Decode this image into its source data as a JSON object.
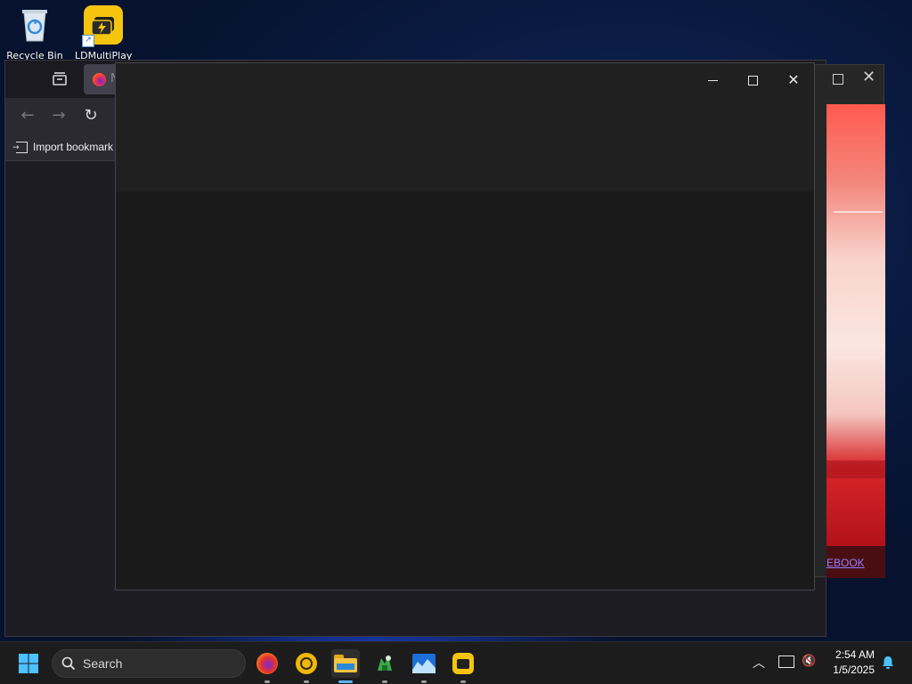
{
  "desktop": {
    "icons": [
      {
        "label": "Recycle Bin",
        "icon": "recycle-bin-icon"
      },
      {
        "label": "LDMultiPlayer",
        "icon": "ldmultiplayer-icon"
      }
    ]
  },
  "browser": {
    "tab_label": "N",
    "import_bookmarks_label": "Import bookmark",
    "icons": [
      "tab-overview-icon",
      "firefox-tab-icon",
      "back-arrow-icon",
      "forward-arrow-icon",
      "reload-icon",
      "import-icon"
    ]
  },
  "game_window": {
    "footer_link": "EBOOK"
  },
  "taskbar": {
    "search_label": "Search",
    "time": "2:54 AM",
    "date": "1/5/2025",
    "apps": [
      "firefox-icon",
      "ldplayer-icon",
      "file-explorer-icon",
      "game-app-icon",
      "mountain-app-icon",
      "ldmultiplayer-icon"
    ]
  },
  "colors": {
    "taskbar_bg": "#1c1c1c",
    "window_bg": "#1a1a1a",
    "titlebar_bg": "#202020",
    "accent_blue": "#5fb2ff"
  }
}
